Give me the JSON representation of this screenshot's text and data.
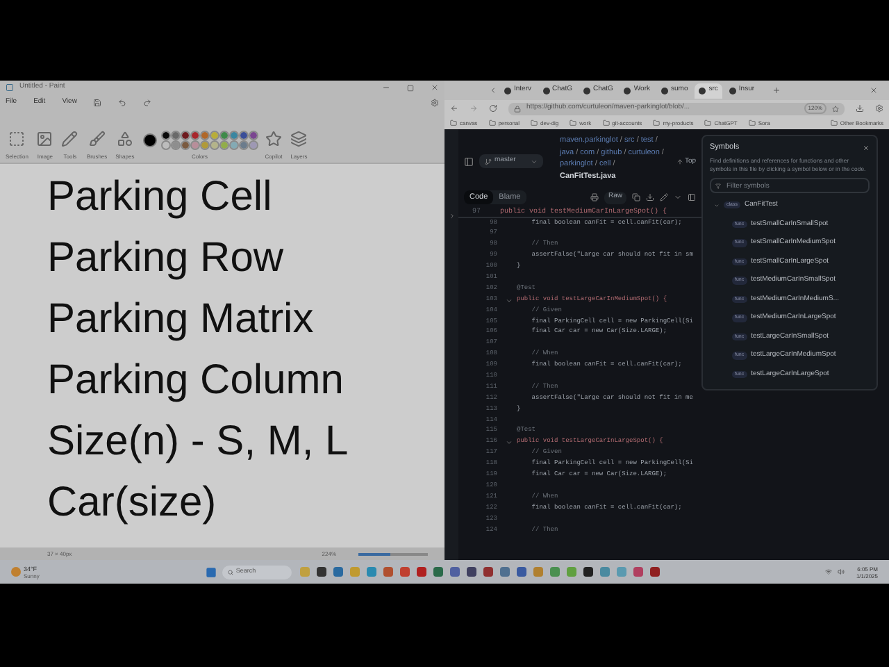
{
  "paint": {
    "title": "Untitled - Paint",
    "menu": [
      "File",
      "Edit",
      "View"
    ],
    "ribbon_groups": [
      "Selection",
      "Image",
      "Tools",
      "Brushes",
      "Shapes",
      "Colors",
      "Copilot",
      "Layers"
    ],
    "palette": [
      {
        "color": "#0a0a0a"
      },
      {
        "color": "#6a6a6a"
      },
      {
        "color": "#6e1a1e"
      },
      {
        "color": "#a8262c"
      },
      {
        "color": "#b0682a"
      },
      {
        "color": "#b8ad3a"
      },
      {
        "color": "#3f8a4a"
      },
      {
        "color": "#3a86a0"
      },
      {
        "color": "#3a4e98"
      },
      {
        "color": "#7a4690"
      },
      {
        "color": "#bdbdbd"
      },
      {
        "color": "#8e8e8e"
      },
      {
        "color": "#7a5a40"
      },
      {
        "color": "#b88e9a"
      },
      {
        "color": "#b09a3a"
      },
      {
        "color": "#b4b48a"
      },
      {
        "color": "#92ad4a"
      },
      {
        "color": "#84aab4"
      },
      {
        "color": "#6c7c8c"
      },
      {
        "color": "#9e98b4"
      }
    ],
    "canvas_lines": [
      "Parking Cell",
      "Parking Row",
      "Parking Matrix",
      "Parking Column",
      "Size(n) - S, M, L",
      "Car(size)"
    ],
    "status": {
      "size": "37 × 40px",
      "zoom": "224%",
      "level": 0.45
    }
  },
  "browser": {
    "tabs": [
      {
        "label": "Interv",
        "selected": false
      },
      {
        "label": "ChatG",
        "selected": false
      },
      {
        "label": "ChatG",
        "selected": false
      },
      {
        "label": "Work",
        "selected": false
      },
      {
        "label": "sumo",
        "selected": false
      },
      {
        "label": "src",
        "selected": true
      },
      {
        "label": "Insur",
        "selected": false
      }
    ],
    "url": "https://github.com/curtuleon/maven-parkinglot/blob/...",
    "zoom": "120%",
    "bookmarks": [
      "canvas",
      "personal",
      "dev-dig",
      "work",
      "git-accounts",
      "my-products",
      "ChatGPT",
      "Sora"
    ],
    "other_bookmarks": "Other Bookmarks"
  },
  "github": {
    "breadcrumb": [
      {
        "name": "maven.parkinglot",
        "separator": "/"
      },
      {
        "name": "src",
        "separator": "/"
      },
      {
        "name": "test",
        "separator": "/"
      },
      {
        "name": "java",
        "separator": "/"
      },
      {
        "name": "com",
        "separator": "/"
      },
      {
        "name": "github",
        "separator": "/"
      },
      {
        "name": "curtuleon",
        "separator": "/"
      },
      {
        "name": "parkinglot",
        "separator": "/"
      },
      {
        "name": "cell",
        "separator": "/"
      }
    ],
    "file": "CanFitTest.java",
    "branch": "master",
    "top": "Top",
    "view_tabs": [
      {
        "label": "Code",
        "selected": true
      },
      {
        "label": "Blame",
        "selected": false
      }
    ],
    "raw": "Raw",
    "sticky_line": {
      "number": "97",
      "text": "public void testMediumCarInLargeSpot() {"
    },
    "code_lines": [
      {
        "number": "98",
        "text": "    final boolean canFit = cell.canFit(car);",
        "kind": "code",
        "fold": false
      },
      {
        "number": "97",
        "fold": false
      },
      {
        "number": "98",
        "text": "    // Then",
        "kind": "comment",
        "fold": false
      },
      {
        "number": "99",
        "text": "    assertFalse(\"Large car should not fit in sm",
        "kind": "code",
        "fold": false
      },
      {
        "number": "100",
        "text": "}",
        "kind": "code",
        "fold": false
      },
      {
        "number": "101",
        "fold": false
      },
      {
        "number": "102",
        "text": "@Test",
        "kind": "comment",
        "fold": false
      },
      {
        "number": "103",
        "text": "public void testLargeCarInMediumSpot() {",
        "kind": "declaration",
        "fold": true
      },
      {
        "number": "104",
        "text": "    // Given",
        "kind": "comment",
        "fold": false
      },
      {
        "number": "105",
        "text": "    final ParkingCell cell = new ParkingCell(Si",
        "kind": "code",
        "fold": false
      },
      {
        "number": "106",
        "text": "    final Car car = new Car(Size.LARGE);",
        "kind": "code",
        "fold": false
      },
      {
        "number": "107",
        "fold": false
      },
      {
        "number": "108",
        "text": "    // When",
        "kind": "comment",
        "fold": false
      },
      {
        "number": "109",
        "text": "    final boolean canFit = cell.canFit(car);",
        "kind": "code",
        "fold": false
      },
      {
        "number": "110",
        "fold": false
      },
      {
        "number": "111",
        "text": "    // Then",
        "kind": "comment",
        "fold": false
      },
      {
        "number": "112",
        "text": "    assertFalse(\"Large car should not fit in me",
        "kind": "code",
        "fold": false
      },
      {
        "number": "113",
        "text": "}",
        "kind": "code",
        "fold": false
      },
      {
        "number": "114",
        "fold": false
      },
      {
        "number": "115",
        "text": "@Test",
        "kind": "comment",
        "fold": false
      },
      {
        "number": "116",
        "text": "public void testLargeCarInLargeSpot() {",
        "kind": "declaration",
        "fold": true
      },
      {
        "number": "117",
        "text": "    // Given",
        "kind": "comment",
        "fold": false
      },
      {
        "number": "118",
        "text": "    final ParkingCell cell = new ParkingCell(Si",
        "kind": "code",
        "fold": false
      },
      {
        "number": "119",
        "text": "    final Car car = new Car(Size.LARGE);",
        "kind": "code",
        "fold": false
      },
      {
        "number": "120",
        "fold": false
      },
      {
        "number": "121",
        "text": "    // When",
        "kind": "comment",
        "fold": false
      },
      {
        "number": "122",
        "text": "    final boolean canFit = cell.canFit(car);",
        "kind": "code",
        "fold": false
      },
      {
        "number": "123",
        "fold": false
      },
      {
        "number": "124",
        "text": "    // Then",
        "kind": "comment",
        "fold": false
      }
    ],
    "symbols": {
      "title": "Symbols",
      "description": "Find definitions and references for functions and other symbols in this file by clicking a symbol below or in the code.",
      "filter_placeholder": "Filter symbols",
      "tree": {
        "tag": "class",
        "name": "CanFitTest",
        "expanded": true,
        "children": [
          {
            "tag": "func",
            "name": "testSmallCarInSmallSpot"
          },
          {
            "tag": "func",
            "name": "testSmallCarInMediumSpot"
          },
          {
            "tag": "func",
            "name": "testSmallCarInLargeSpot"
          },
          {
            "tag": "func",
            "name": "testMediumCarInSmallSpot"
          },
          {
            "tag": "func",
            "name": "testMediumCarInMediumS..."
          },
          {
            "tag": "func",
            "name": "testMediumCarInLargeSpot"
          },
          {
            "tag": "func",
            "name": "testLargeCarInSmallSpot"
          },
          {
            "tag": "func",
            "name": "testLargeCarInMediumSpot"
          },
          {
            "tag": "func",
            "name": "testLargeCarInLargeSpot"
          }
        ]
      }
    }
  },
  "taskbar": {
    "weather_temp": "34°F",
    "weather_desc": "Sunny",
    "search_placeholder": "Search",
    "time": "6:05 PM",
    "date": "1/1/2025"
  }
}
